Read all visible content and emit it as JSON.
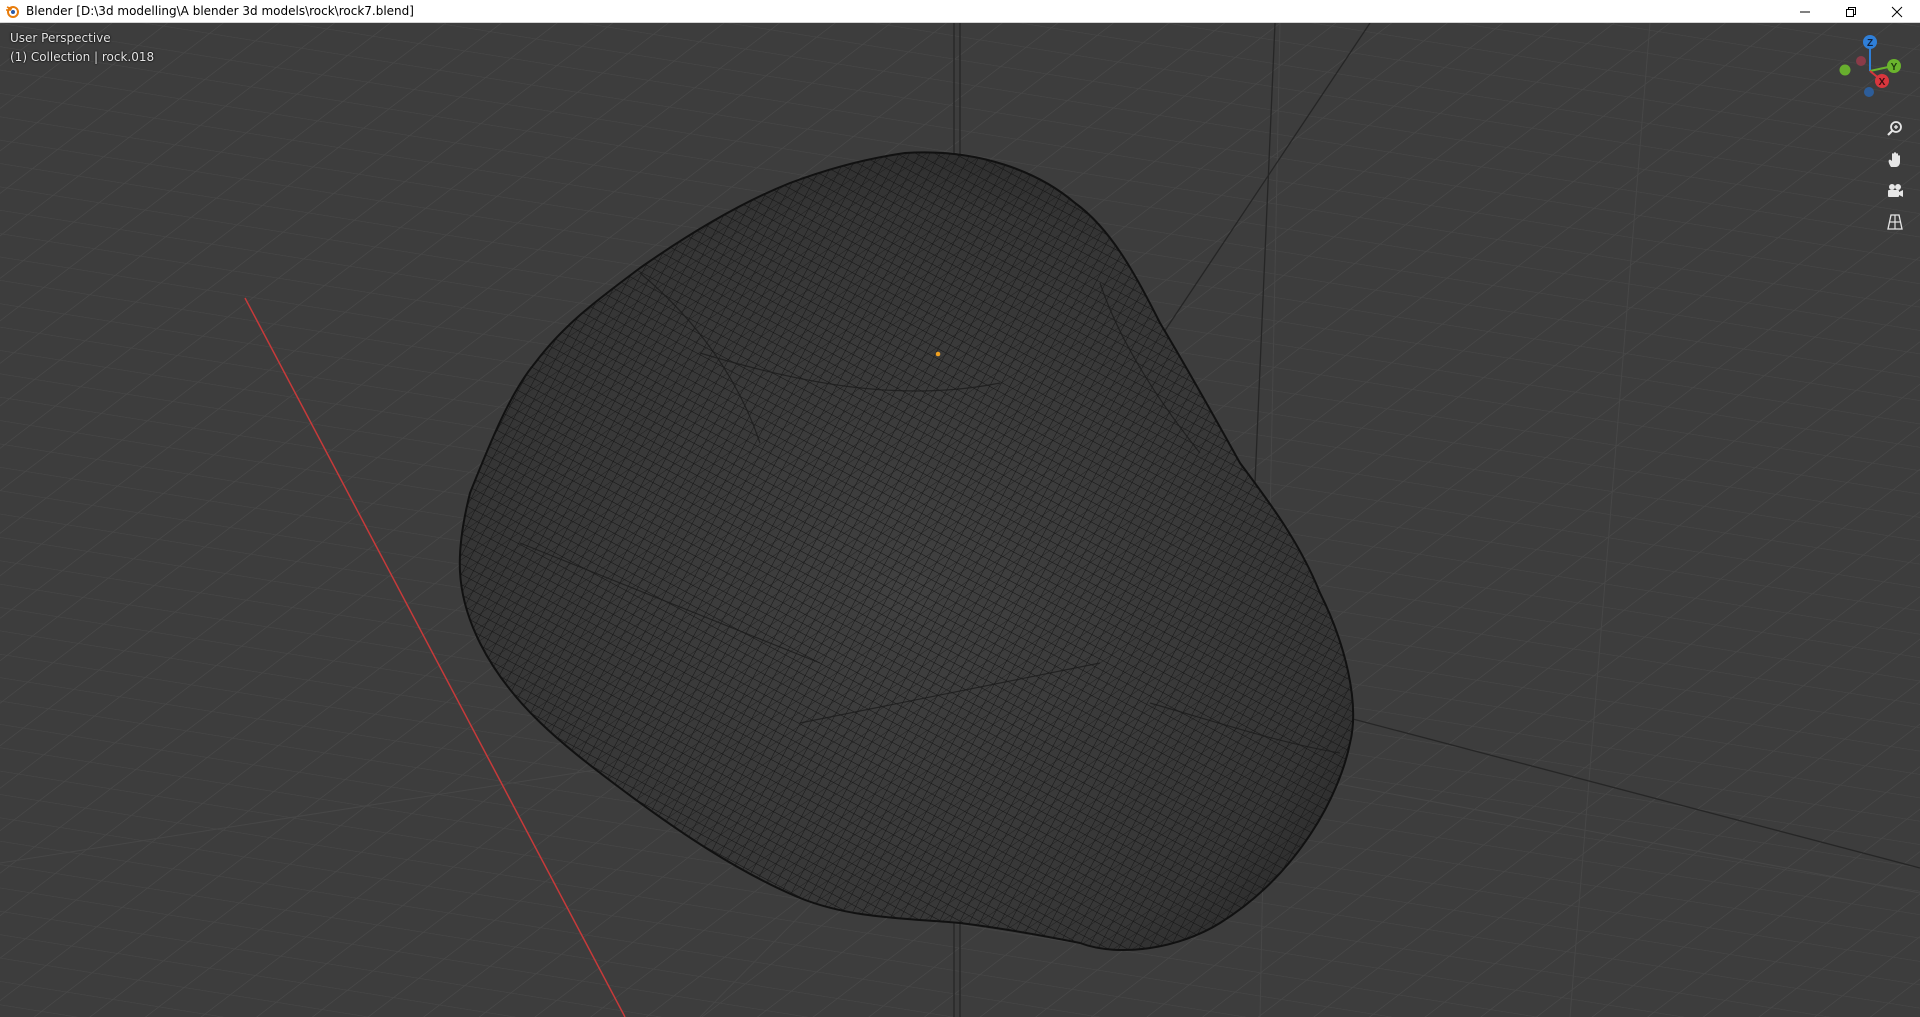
{
  "window": {
    "title": "Blender [D:\\3d modelling\\A blender 3d models\\rock\\rock7.blend]",
    "controls": [
      "minimize-icon",
      "restore-icon",
      "close-icon"
    ]
  },
  "viewport": {
    "view_label": "User Perspective",
    "object_label": "(1) Collection | rock.018",
    "background_color": "#3d3d3d",
    "x_axis_color": "#c63a3a",
    "origin_dot_color": "#f0a020"
  },
  "gizmo": {
    "axes": [
      {
        "label": "Z",
        "color": "#2f7fd8"
      },
      {
        "label": "Y",
        "color": "#6ab42d"
      },
      {
        "label": "X",
        "color": "#d8363d"
      }
    ]
  },
  "nav_buttons": [
    {
      "name": "zoom-icon"
    },
    {
      "name": "hand-pan-icon"
    },
    {
      "name": "camera-icon"
    },
    {
      "name": "grid-perspective-icon"
    }
  ]
}
